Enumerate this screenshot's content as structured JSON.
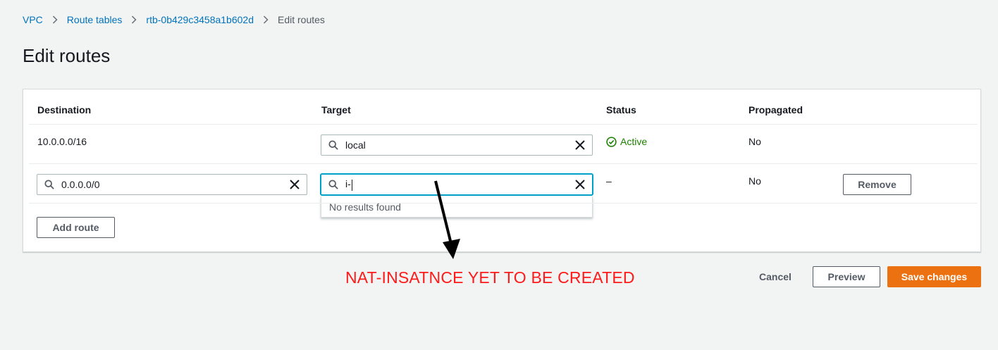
{
  "breadcrumb": {
    "items": [
      {
        "label": "VPC"
      },
      {
        "label": "Route tables"
      },
      {
        "label": "rtb-0b429c3458a1b602d"
      }
    ],
    "current": "Edit routes"
  },
  "page_title": "Edit routes",
  "table": {
    "headers": {
      "destination": "Destination",
      "target": "Target",
      "status": "Status",
      "propagated": "Propagated"
    },
    "rows": [
      {
        "destination": "10.0.0.0/16",
        "target": "local",
        "status": "Active",
        "propagated": "No"
      },
      {
        "destination": "0.0.0.0/0",
        "target": "i-",
        "status": "–",
        "propagated": "No",
        "remove_label": "Remove",
        "dropdown_message": "No results found"
      }
    ]
  },
  "add_route_label": "Add route",
  "footer": {
    "cancel_label": "Cancel",
    "preview_label": "Preview",
    "save_label": "Save changes"
  },
  "annotation": {
    "text": "NAT-INSATNCE YET TO BE CREATED",
    "color": "#ff1a1a"
  },
  "colors": {
    "link": "#0073bb",
    "primary": "#ec7211",
    "active": "#1d8102",
    "focus": "#00a1c9"
  }
}
